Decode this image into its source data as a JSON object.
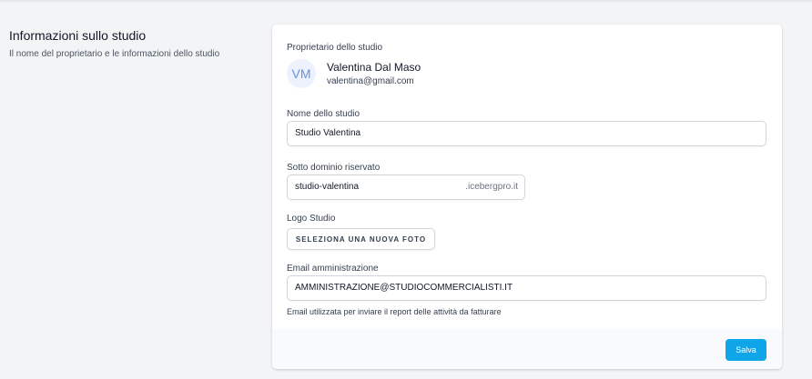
{
  "section": {
    "title": "Informazioni sullo studio",
    "description": "Il nome del proprietario e le informazioni dello studio"
  },
  "owner": {
    "label": "Proprietario dello studio",
    "initials": "VM",
    "name": "Valentina Dal Maso",
    "email": "valentina@gmail.com"
  },
  "studio_name": {
    "label": "Nome dello studio",
    "value": "Studio Valentina"
  },
  "subdomain": {
    "label": "Sotto dominio riservato",
    "value": "studio-valentina",
    "suffix": ".icebergpro.it"
  },
  "logo": {
    "label": "Logo Studio",
    "button_label": "SELEZIONA UNA NUOVA FOTO"
  },
  "admin_email": {
    "label": "Email amministrazione",
    "value": "AMMINISTRAZIONE@STUDIOCOMMERCIALISTI.IT",
    "help": "Email utilizzata per inviare il report delle attività da fatturare"
  },
  "footer": {
    "save_label": "Salva"
  },
  "colors": {
    "accent": "#0ea5e9",
    "avatar_bg": "#eef2ff",
    "avatar_text": "#6b8fdb"
  }
}
